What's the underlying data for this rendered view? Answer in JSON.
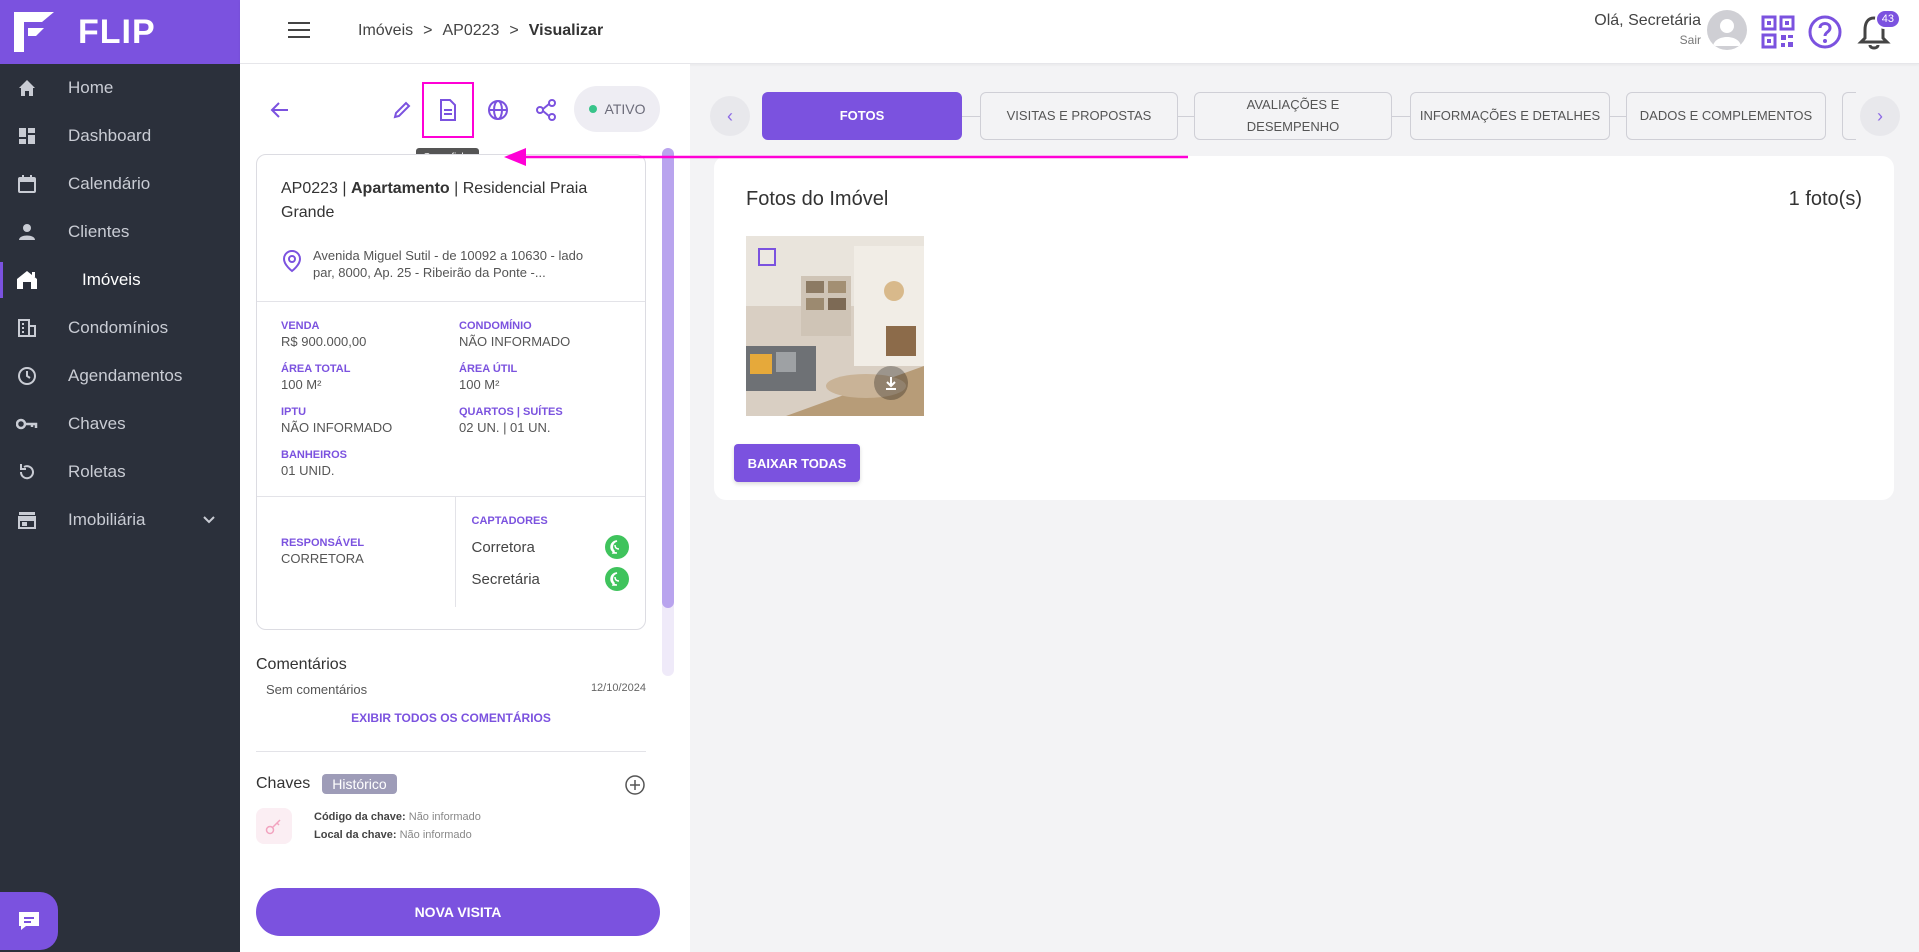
{
  "brand": {
    "name": "FLIP",
    "accent": "#7b52df",
    "sidebar_bg": "#2b303b"
  },
  "sidebar": {
    "items": [
      {
        "label": "Home",
        "icon": "home-icon"
      },
      {
        "label": "Dashboard",
        "icon": "dashboard-icon"
      },
      {
        "label": "Calendário",
        "icon": "calendar-icon"
      },
      {
        "label": "Clientes",
        "icon": "person-icon"
      },
      {
        "label": "Imóveis",
        "icon": "house-icon",
        "active": true
      },
      {
        "label": "Condomínios",
        "icon": "building-icon"
      },
      {
        "label": "Agendamentos",
        "icon": "clock-icon"
      },
      {
        "label": "Chaves",
        "icon": "key-icon"
      },
      {
        "label": "Roletas",
        "icon": "refresh-icon"
      },
      {
        "label": "Imobiliária",
        "icon": "store-icon",
        "expandable": true
      }
    ]
  },
  "topbar": {
    "breadcrumb": [
      "Imóveis",
      "AP0223",
      "Visualizar"
    ],
    "separator": ">",
    "greeting": "Olá, Secretária",
    "logout": "Sair",
    "notifications": "43"
  },
  "actions": {
    "status": "ATIVO",
    "tooltip": "Gerar ficha"
  },
  "property": {
    "code": "AP0223",
    "type": "Apartamento",
    "name": "Residencial Praia Grande",
    "address_line1": "Avenida Miguel Sutil - de 10092 a 10630 - lado",
    "address_line2": "par, 8000, Ap. 25 - Ribeirão da Ponte -...",
    "specs": [
      {
        "k": "VENDA",
        "v": "R$ 900.000,00"
      },
      {
        "k": "CONDOMÍNIO",
        "v": "NÃO INFORMADO"
      },
      {
        "k": "ÁREA TOTAL",
        "v": "100 M²"
      },
      {
        "k": "ÁREA ÚTIL",
        "v": "100 M²"
      },
      {
        "k": "IPTU",
        "v": "NÃO INFORMADO"
      },
      {
        "k": "QUARTOS | SUÍTES",
        "v": "02 UN. | 01 UN."
      },
      {
        "k": "BANHEIROS",
        "v": "01 UNID."
      }
    ],
    "responsavel_label": "RESPONSÁVEL",
    "responsavel": "CORRETORA",
    "captadores_label": "CAPTADORES",
    "captadores": [
      "Corretora",
      "Secretária"
    ]
  },
  "comments": {
    "title": "Comentários",
    "text": "Sem comentários",
    "date": "12/10/2024",
    "link": "EXIBIR TODOS OS COMENTÁRIOS"
  },
  "keys": {
    "title": "Chaves",
    "badge": "Histórico",
    "code_label": "Código da chave:",
    "code_value": "Não informado",
    "place_label": "Local da chave:",
    "place_value": "Não informado"
  },
  "nova_visita": "NOVA VISITA",
  "tabs": [
    {
      "label": "FOTOS",
      "active": true
    },
    {
      "label": "VISITAS E PROPOSTAS"
    },
    {
      "label": "AVALIAÇÕES E DESEMPENHO"
    },
    {
      "label": "INFORMAÇÕES E DETALHES"
    },
    {
      "label": "DADOS E COMPLEMENTOS"
    }
  ],
  "photos": {
    "title": "Fotos do Imóvel",
    "count": "1 foto(s)",
    "download_all": "BAIXAR TODAS"
  }
}
